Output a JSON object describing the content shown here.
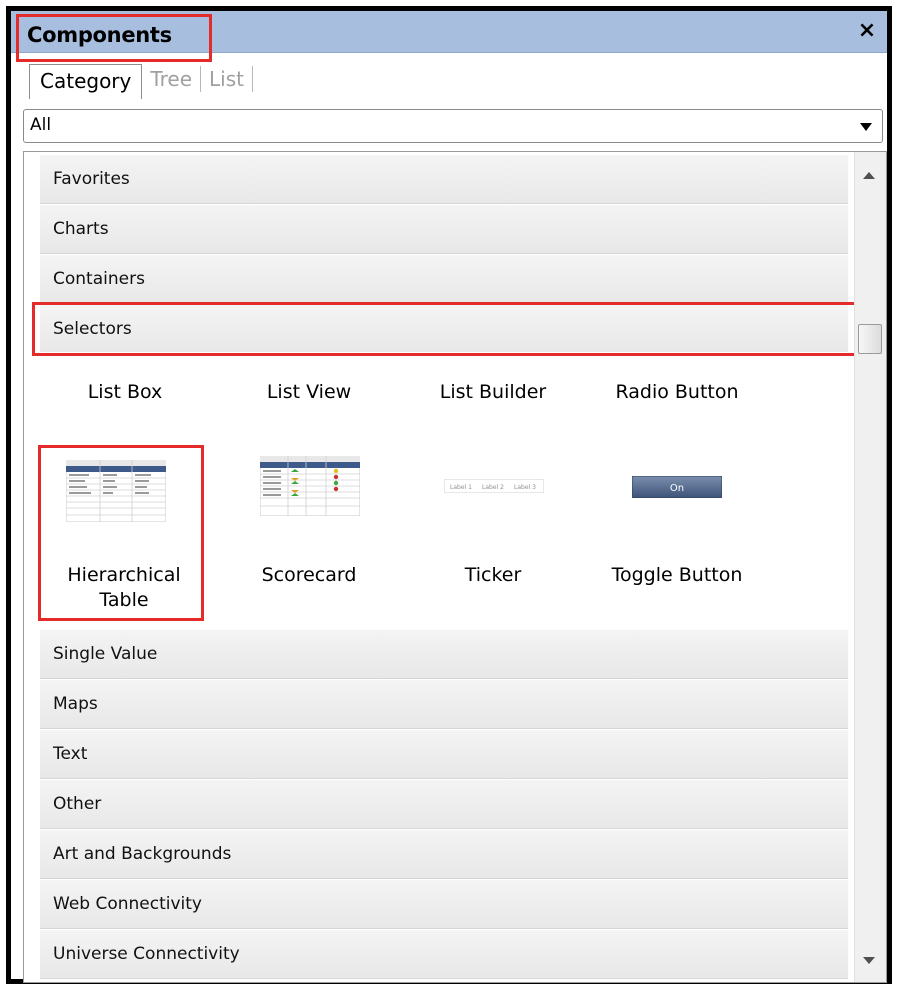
{
  "panel": {
    "title": "Components",
    "close_glyph": "×"
  },
  "tabs": [
    {
      "label": "Category",
      "active": true
    },
    {
      "label": "Tree",
      "active": false
    },
    {
      "label": "List",
      "active": false
    }
  ],
  "filter": {
    "value": "All"
  },
  "categories_top": [
    {
      "label": "Favorites"
    },
    {
      "label": "Charts"
    },
    {
      "label": "Containers"
    },
    {
      "label": "Selectors"
    }
  ],
  "selectors_components": [
    {
      "label": "List Box"
    },
    {
      "label": "List View"
    },
    {
      "label": "List Builder"
    },
    {
      "label": "Radio Button"
    },
    {
      "label": "Hierarchical Table"
    },
    {
      "label": "Scorecard"
    },
    {
      "label": "Ticker"
    },
    {
      "label": "Toggle Button"
    }
  ],
  "thumb_text": {
    "toggle": "On",
    "ticker_1": "Label 1",
    "ticker_2": "Label 2",
    "ticker_3": "Label 3"
  },
  "categories_bottom": [
    {
      "label": "Single Value"
    },
    {
      "label": "Maps"
    },
    {
      "label": "Text"
    },
    {
      "label": "Other"
    },
    {
      "label": "Art and Backgrounds"
    },
    {
      "label": "Web Connectivity"
    },
    {
      "label": "Universe Connectivity"
    }
  ],
  "colors": {
    "titlebar": "#a7bedf",
    "highlight": "#e52a2a",
    "category_row": "#eeeeee"
  },
  "icons": {
    "close": "close-icon",
    "dropdown": "chevron-down-icon",
    "scroll_up": "scroll-up-icon",
    "scroll_down": "scroll-down-icon"
  }
}
